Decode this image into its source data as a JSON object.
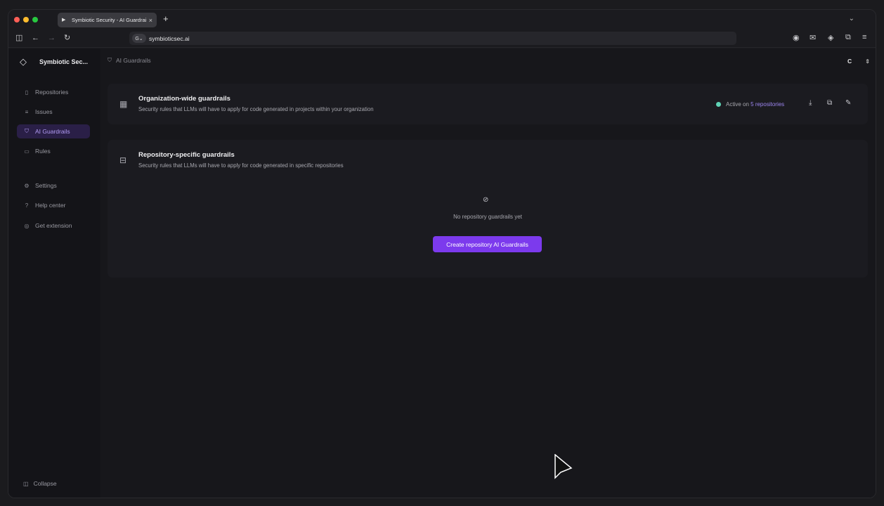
{
  "browser": {
    "tab_title": "Symbiotic Security - AI Guardrails",
    "tab_close": "×",
    "new_tab": "+",
    "url": "symbioticsec.ai"
  },
  "sidebar": {
    "brand_name": "Symbiotic Sec...",
    "items": [
      {
        "label": "Repositories",
        "icon": "book-icon"
      },
      {
        "label": "Issues",
        "icon": "list-icon"
      },
      {
        "label": "AI Guardrails",
        "icon": "shield-icon",
        "active": true
      },
      {
        "label": "Rules",
        "icon": "document-icon"
      },
      {
        "label": "Settings",
        "icon": "gear-icon"
      },
      {
        "label": "Help center",
        "icon": "help-icon"
      },
      {
        "label": "Get extension",
        "icon": "globe-icon"
      }
    ],
    "collapse_label": "Collapse"
  },
  "header": {
    "breadcrumb": "AI Guardrails",
    "org_initial": "C"
  },
  "org_guardrails": {
    "title": "Organization-wide guardrails",
    "subtitle": "Security rules that LLMs will have to apply for code generated in projects within your organization",
    "status_prefix": "Active on",
    "status_link": "5 repositories"
  },
  "repo_guardrails": {
    "title": "Repository-specific guardrails",
    "subtitle": "Security rules that LLMs will have to apply for code generated in specific repositories",
    "empty_text": "No repository guardrails yet",
    "create_button": "Create repository AI Guardrails"
  },
  "colors": {
    "accent": "#7c3aed",
    "active_nav_bg": "#2a1f47",
    "status_dot": "#5fd3b5"
  }
}
